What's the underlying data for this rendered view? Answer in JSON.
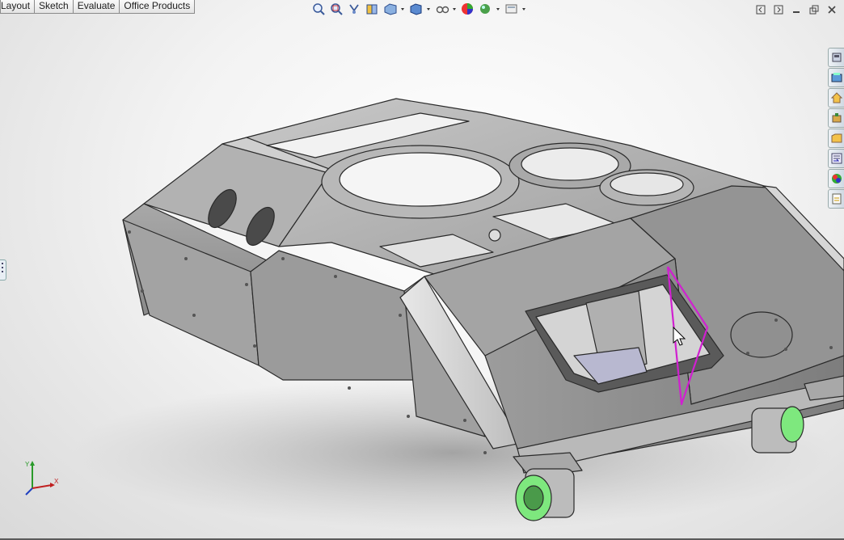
{
  "command_tabs": [
    "Layout",
    "Sketch",
    "Evaluate",
    "Office Products"
  ],
  "hud_tools": [
    "zoom-to-fit-icon",
    "zoom-to-area-icon",
    "previous-view-icon",
    "section-view-icon",
    "view-orientation-icon",
    "display-style-icon",
    "hide-show-items-icon",
    "edit-appearance-icon",
    "apply-scene-icon",
    "view-settings-icon"
  ],
  "task_pane": [
    "resources-icon",
    "design-library-icon",
    "file-explorer-icon",
    "search-icon",
    "view-palette-icon",
    "custom-properties-icon",
    "appearances-icon",
    "document-recovery-icon"
  ],
  "triad_axes": [
    "Y",
    "X"
  ],
  "colors": {
    "part_body": "#9a9a9a",
    "part_face_light": "#cfcfcf",
    "part_face_dark": "#6f6f6f",
    "edge": "#2a2a2a",
    "wheel": "#7ee87e",
    "highlight_sketch": "#d020d0"
  }
}
